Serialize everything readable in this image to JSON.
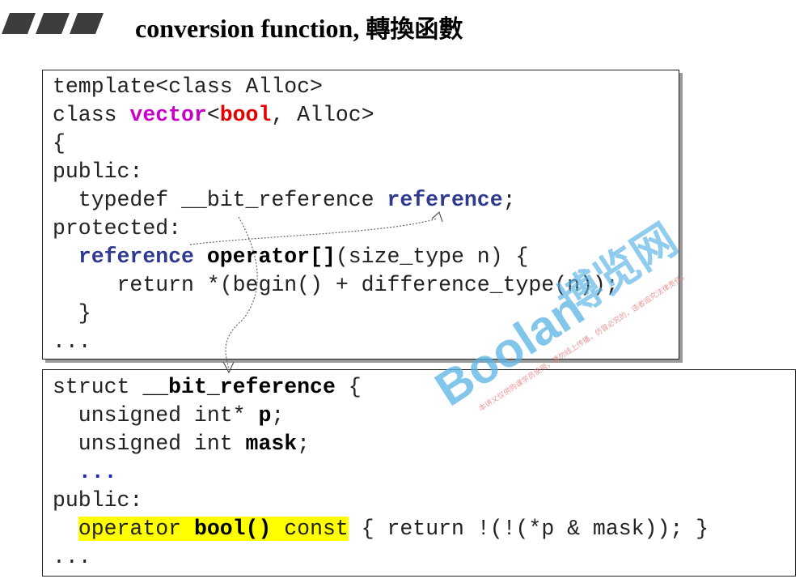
{
  "slide": {
    "title": "conversion function,",
    "title_cjk": "轉換函數"
  },
  "box1": {
    "l1": "template<class Alloc>",
    "l2_a": "class ",
    "l2_b": "vector",
    "l2_c": "<",
    "l2_d": "bool",
    "l2_e": ", Alloc>",
    "l3": "{",
    "l4": "public:",
    "l5_a": "  typedef __bit_reference ",
    "l5_b": "reference",
    "l5_c": ";",
    "l6": "protected:",
    "l7_a": "  ",
    "l7_b": "reference",
    "l7_c": " ",
    "l7_d": "operator[]",
    "l7_e": "(size_type n) {",
    "l8": "     return *(begin() + difference_type(n));",
    "l9": "  }",
    "l10": "..."
  },
  "box2": {
    "l1_a": "struct ",
    "l1_b": "__bit_reference",
    "l1_c": " {",
    "l2_a": "  unsigned int* ",
    "l2_b": "p",
    "l2_c": ";",
    "l3_a": "  unsigned int ",
    "l3_b": "mask",
    "l3_c": ";",
    "l4_a": "  ",
    "l4_b": "...",
    "l5": "public:",
    "l6_a": "  ",
    "l6_b": "operator ",
    "l6_c": "bool()",
    "l6_d": " const",
    "l6_e": " { return !(!(*p & mask)); }",
    "l7": "..."
  },
  "watermark": {
    "logo": "Boolan",
    "cjk": "博览网",
    "note": "本讲义仅供购课学员使用，请勿线上传播，仿冒必究的，违者追究法律责任。"
  },
  "colors": {
    "decor_bars": "#3d3d3d",
    "keyword_magenta": "#c800c8",
    "keyword_red": "#e60000",
    "keyword_blue": "#2f3a8f",
    "highlight": "#ffff00",
    "watermark_blue": "#5ab4e6"
  }
}
